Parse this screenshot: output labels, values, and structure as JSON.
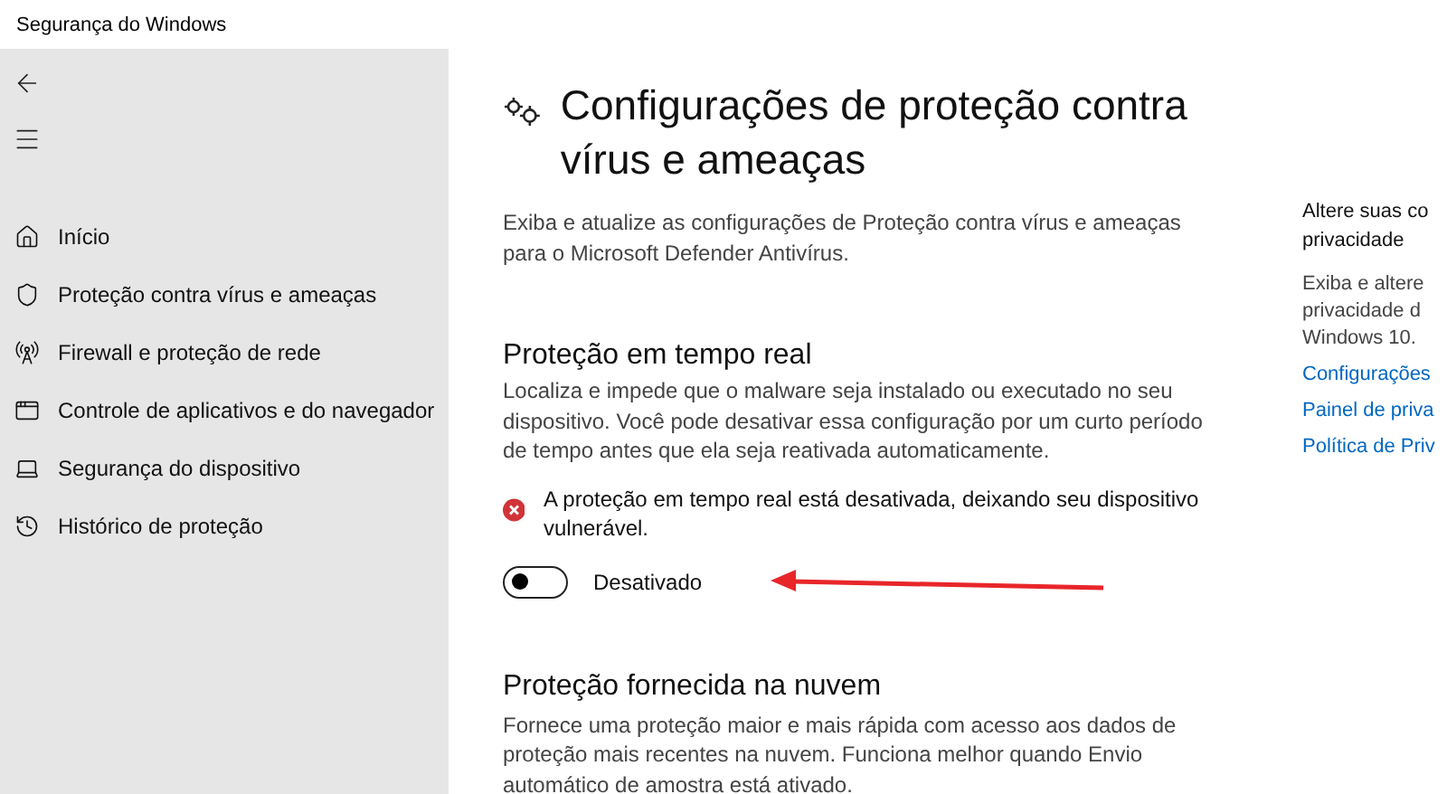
{
  "window": {
    "title": "Segurança do Windows"
  },
  "sidebar": {
    "items": [
      {
        "label": "Início",
        "kind": "home",
        "selected": false
      },
      {
        "label": "Proteção contra vírus e ameaças",
        "kind": "shield",
        "selected": false
      },
      {
        "label": "Firewall e proteção de rede",
        "kind": "antenna",
        "selected": false
      },
      {
        "label": "Controle de aplicativos e do navegador",
        "kind": "window",
        "selected": false
      },
      {
        "label": "Segurança do dispositivo",
        "kind": "laptop",
        "selected": false
      },
      {
        "label": "Histórico de proteção",
        "kind": "history",
        "selected": false
      }
    ]
  },
  "page": {
    "title": "Configurações de proteção contra vírus e ameaças",
    "description": "Exiba e atualize as configurações de Proteção contra vírus e ameaças para o Microsoft Defender Antivírus."
  },
  "realtime": {
    "title": "Proteção em tempo real",
    "description": "Localiza e impede que o malware seja instalado ou executado no seu dispositivo. Você pode desativar essa configuração por um curto período de tempo antes que ela seja reativada automaticamente.",
    "warning": "A proteção em tempo real está desativada, deixando seu dispositivo vulnerável.",
    "toggle": {
      "on": false,
      "label": "Desativado"
    }
  },
  "cloud": {
    "title": "Proteção fornecida na nuvem",
    "description": "Fornece uma proteção maior e mais rápida com acesso aos dados de proteção mais recentes na nuvem. Funciona melhor quando Envio automático de amostra está ativado."
  },
  "privacy": {
    "title": "Altere suas co",
    "title_line_2": "privacidade",
    "description": [
      "Exiba e altere",
      "privacidade d",
      "Windows 10."
    ],
    "links": [
      "Configurações",
      "Painel de priva",
      "Política de Priv"
    ]
  }
}
